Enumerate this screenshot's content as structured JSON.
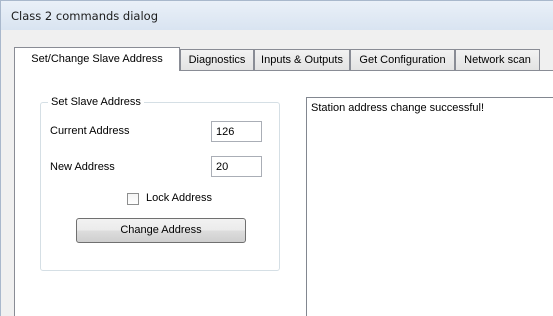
{
  "window": {
    "title": "Class 2 commands dialog"
  },
  "tabs": [
    {
      "label": "Set/Change Slave Address",
      "active": true
    },
    {
      "label": "Diagnostics",
      "active": false
    },
    {
      "label": "Inputs & Outputs",
      "active": false
    },
    {
      "label": "Get Configuration",
      "active": false
    },
    {
      "label": "Network scan",
      "active": false
    }
  ],
  "set_slave_address": {
    "group_label": "Set Slave Address",
    "current_address_label": "Current Address",
    "current_address_value": "126",
    "new_address_label": "New Address",
    "new_address_value": "20",
    "lock_address_label": "Lock Address",
    "lock_address_checked": false,
    "change_button_label": "Change Address"
  },
  "log": {
    "message": "Station address change successful!"
  }
}
